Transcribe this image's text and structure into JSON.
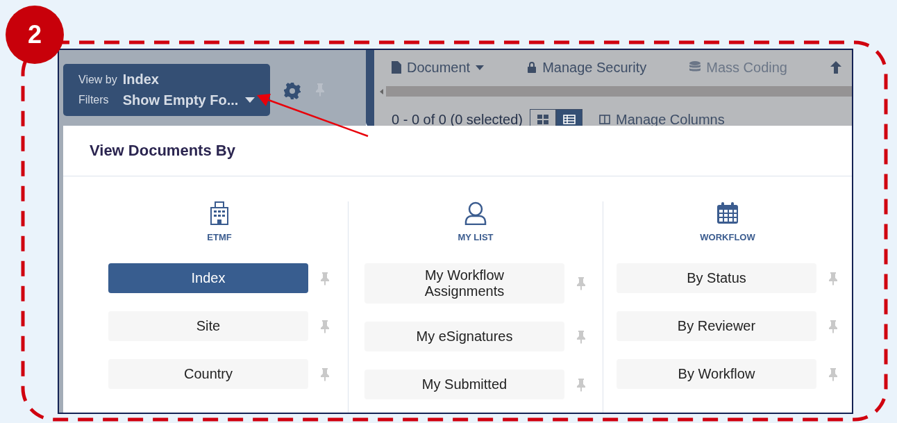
{
  "annotation": {
    "step": "2"
  },
  "view_by": {
    "label": "View by",
    "value": "Index",
    "filters_label": "Filters",
    "filters_value": "Show Empty Fo..."
  },
  "toolbar": [
    {
      "label": "Document",
      "kind": "document",
      "disabled": false
    },
    {
      "label": "Manage Security",
      "kind": "lock",
      "disabled": false
    },
    {
      "label": "Mass Coding",
      "kind": "database",
      "disabled": true
    }
  ],
  "results": {
    "count": "0 - 0 of 0 (0 selected)",
    "views": [
      {
        "kind": "tiles",
        "selected": false
      },
      {
        "kind": "list",
        "selected": true
      }
    ],
    "manage_columns": "Manage Columns"
  },
  "dialog": {
    "title": "View Documents By",
    "columns": [
      {
        "heading": "ETMF",
        "kind": "building",
        "items": [
          {
            "label": "Index",
            "selected": true
          },
          {
            "label": "Site",
            "selected": false
          },
          {
            "label": "Country",
            "selected": false
          }
        ]
      },
      {
        "heading": "MY LIST",
        "kind": "person",
        "items": [
          {
            "label": "My Workflow Assignments",
            "selected": false
          },
          {
            "label": "My eSignatures",
            "selected": false
          },
          {
            "label": "My Submitted",
            "selected": false
          }
        ]
      },
      {
        "heading": "WORKFLOW",
        "kind": "calendar",
        "items": [
          {
            "label": "By Status",
            "selected": false
          },
          {
            "label": "By Reviewer",
            "selected": false
          },
          {
            "label": "By Workflow",
            "selected": false
          }
        ]
      }
    ]
  }
}
